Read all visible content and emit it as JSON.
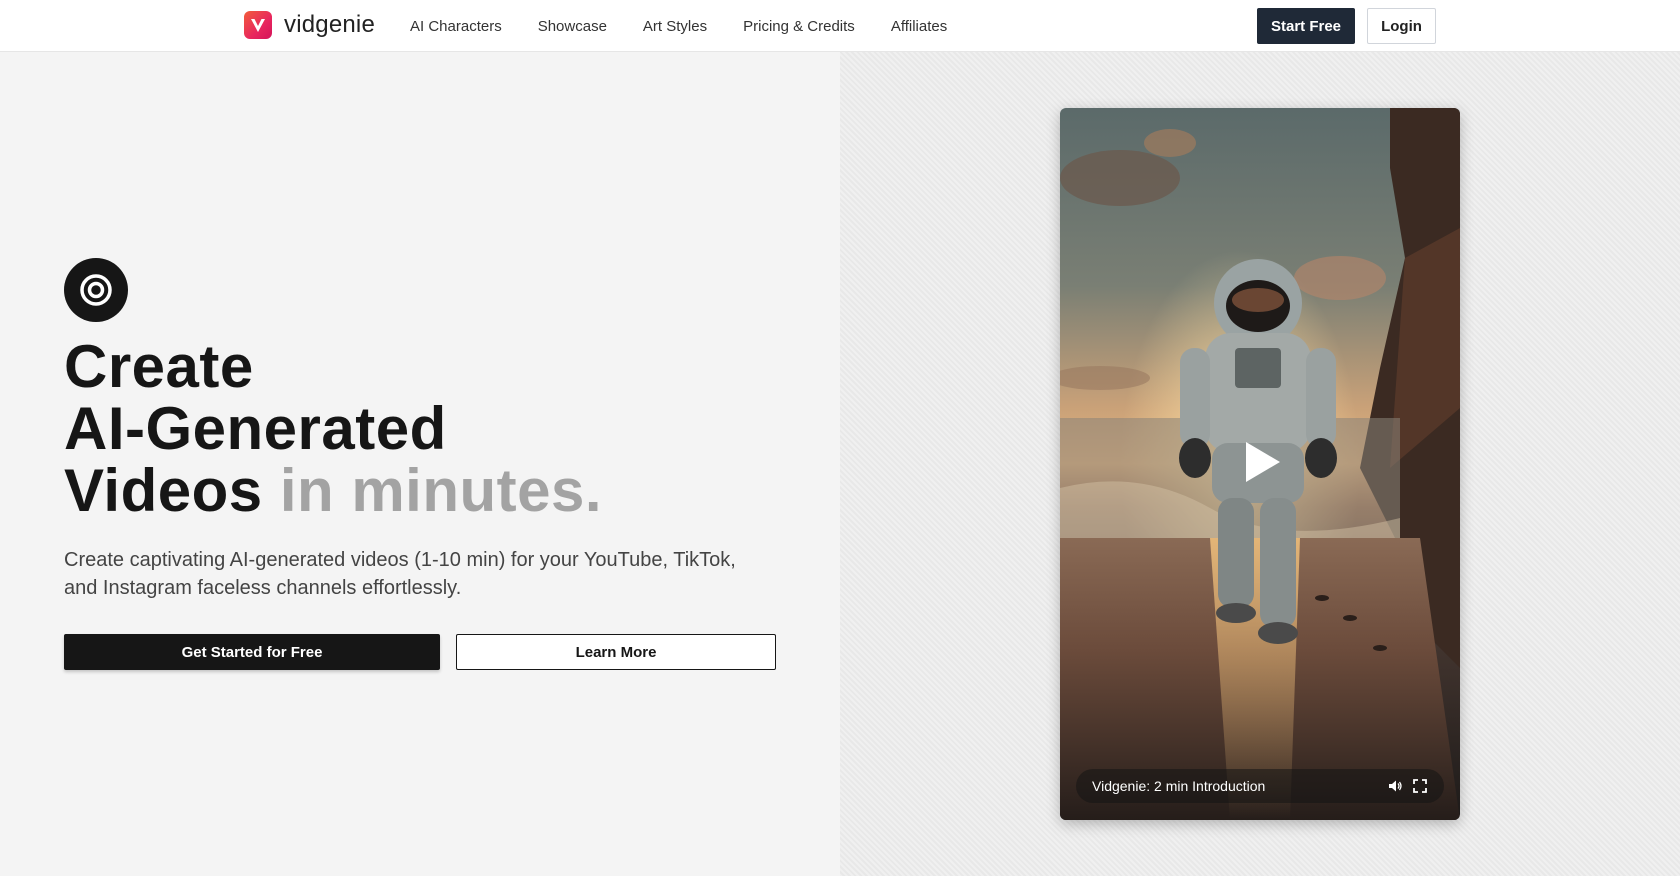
{
  "brand": {
    "name": "vidgenie",
    "logo_letter": "V"
  },
  "nav": {
    "items": [
      {
        "label": "AI Characters"
      },
      {
        "label": "Showcase"
      },
      {
        "label": "Art Styles"
      },
      {
        "label": "Pricing & Credits"
      },
      {
        "label": "Affiliates"
      }
    ]
  },
  "header_actions": {
    "start_label": "Start Free",
    "login_label": "Login"
  },
  "hero": {
    "badge_icon": "target-icon",
    "headline_line1": "Create",
    "headline_line2": "AI-Generated",
    "headline_line3_strong": "Videos",
    "headline_line3_muted": "in minutes.",
    "subtext": "Create captivating AI-generated videos (1-10 min) for your YouTube, TikTok, and Instagram faceless channels effortlessly.",
    "primary_cta": "Get Started for Free",
    "secondary_cta": "Learn More"
  },
  "video": {
    "title": "Vidgenie: 2 min Introduction",
    "icons": [
      "play-icon",
      "volume-icon",
      "fullscreen-icon"
    ]
  },
  "colors": {
    "brand_gradient_start": "#f25c3b",
    "brand_gradient_end": "#d4145a",
    "dark": "#161616",
    "muted_headline": "#a3a3a3",
    "start_button": "#1f2937"
  }
}
